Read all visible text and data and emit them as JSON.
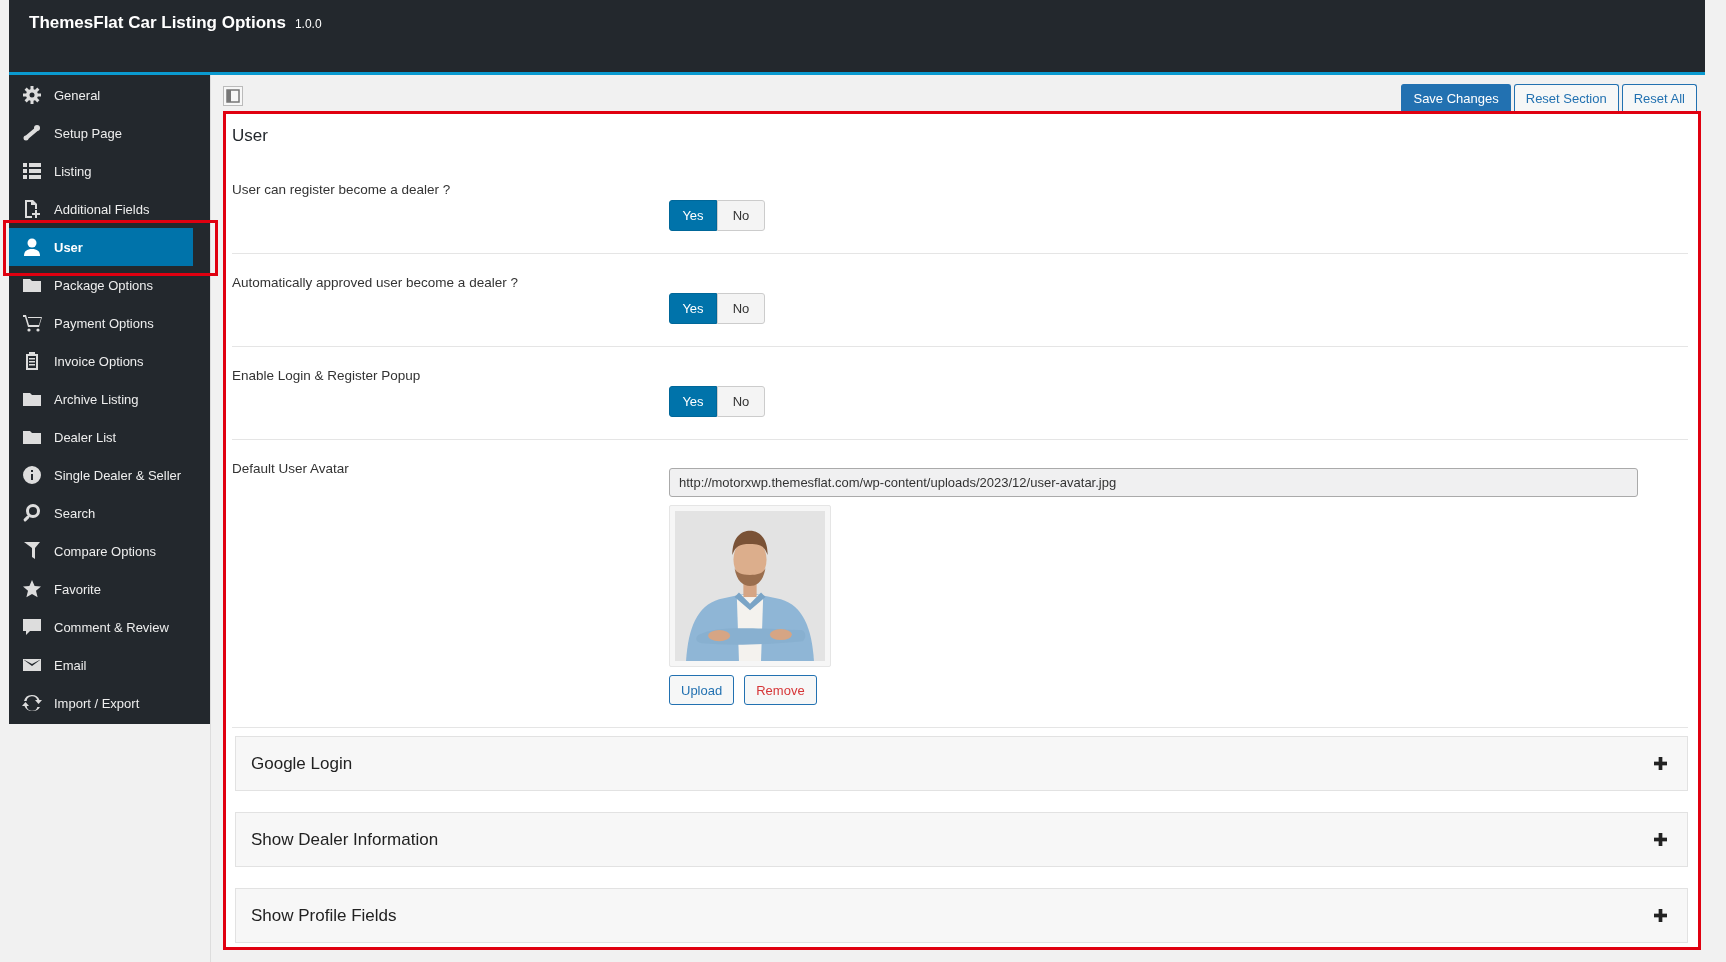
{
  "header": {
    "title": "ThemesFlat Car Listing Options",
    "version": "1.0.0"
  },
  "sidebar": {
    "items": [
      {
        "label": "General",
        "selected": false
      },
      {
        "label": "Setup Page",
        "selected": false
      },
      {
        "label": "Listing",
        "selected": false
      },
      {
        "label": "Additional Fields",
        "selected": false
      },
      {
        "label": "User",
        "selected": true
      },
      {
        "label": "Package Options",
        "selected": false
      },
      {
        "label": "Payment Options",
        "selected": false
      },
      {
        "label": "Invoice Options",
        "selected": false
      },
      {
        "label": "Archive Listing",
        "selected": false
      },
      {
        "label": "Dealer List",
        "selected": false
      },
      {
        "label": "Single Dealer & Seller",
        "selected": false
      },
      {
        "label": "Search",
        "selected": false
      },
      {
        "label": "Compare Options",
        "selected": false
      },
      {
        "label": "Favorite",
        "selected": false
      },
      {
        "label": "Comment & Review",
        "selected": false
      },
      {
        "label": "Email",
        "selected": false
      },
      {
        "label": "Import / Export",
        "selected": false
      }
    ]
  },
  "toolbar": {
    "buttons": [
      {
        "label": "Save Changes",
        "kind": "primary"
      },
      {
        "label": "Reset Section",
        "kind": "secondary"
      },
      {
        "label": "Reset All",
        "kind": "secondary"
      }
    ]
  },
  "section": {
    "title": "User",
    "settings": [
      {
        "kind": "switch",
        "label": "User can register become a dealer ?",
        "options": [
          {
            "label": "Yes",
            "selected": true
          },
          {
            "label": "No",
            "selected": false
          }
        ]
      },
      {
        "kind": "switch",
        "label": "Automatically approved user become a dealer ?",
        "options": [
          {
            "label": "Yes",
            "selected": true
          },
          {
            "label": "No",
            "selected": false
          }
        ]
      },
      {
        "kind": "switch",
        "label": "Enable Login & Register Popup",
        "options": [
          {
            "label": "Yes",
            "selected": true
          },
          {
            "label": "No",
            "selected": false
          }
        ]
      },
      {
        "kind": "media",
        "label": "Default User Avatar",
        "value": "http://motorxwp.themesflat.com/wp-content/uploads/2023/12/user-avatar.jpg",
        "image": {
          "kind": "picture"
        },
        "buttons": [
          {
            "label": "Upload",
            "kind": "upload"
          },
          {
            "label": "Remove",
            "kind": "remove"
          }
        ]
      }
    ],
    "accordions": [
      {
        "title": "Google Login",
        "expanded": false
      },
      {
        "title": "Show Dealer Information",
        "expanded": false
      },
      {
        "title": "Show Profile Fields",
        "expanded": false
      }
    ]
  }
}
